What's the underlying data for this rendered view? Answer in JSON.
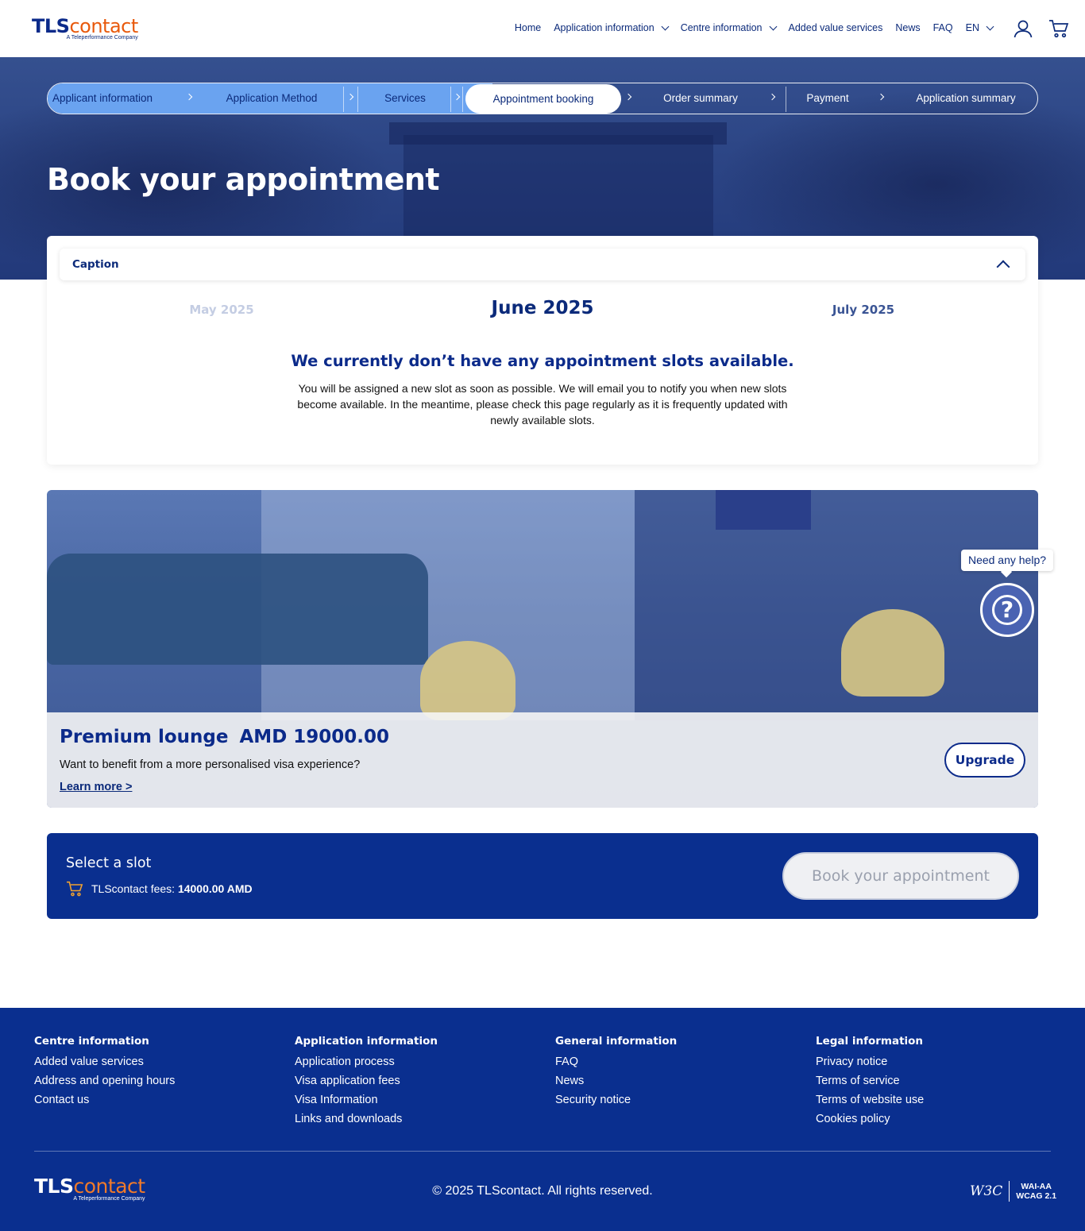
{
  "header": {
    "logo": {
      "brand_a": "TLS",
      "brand_b": "contact",
      "tagline": "A Teleperformance Company"
    },
    "nav": [
      {
        "label": "Home"
      },
      {
        "label": "Application information"
      },
      {
        "label": "Centre information"
      },
      {
        "label": "Added value services"
      },
      {
        "label": "News"
      },
      {
        "label": "FAQ"
      },
      {
        "label": "EN"
      }
    ],
    "icons": {
      "user": "user-icon",
      "cart": "cart-icon"
    }
  },
  "stepper": {
    "steps": [
      {
        "label": "Applicant information",
        "state": "done"
      },
      {
        "label": "Application Method",
        "state": "done"
      },
      {
        "label": "Services",
        "state": "done"
      },
      {
        "label": "Appointment booking",
        "state": "current"
      },
      {
        "label": "Order summary",
        "state": "todo"
      },
      {
        "label": "Payment",
        "state": "todo"
      },
      {
        "label": "Application summary",
        "state": "todo"
      }
    ]
  },
  "hero": {
    "title": "Book your appointment"
  },
  "calendar": {
    "caption": "Caption",
    "prev_month": "May 2025",
    "current_month": "June 2025",
    "next_month": "July 2025",
    "empty_title": "We currently don’t have any appointment slots available.",
    "empty_body": "You will be assigned a new slot as soon as possible. We will email you to notify you when new slots become available. In the meantime, please check this page regularly as it is frequently updated with newly available slots."
  },
  "lounge": {
    "title": "Premium lounge",
    "price": "AMD 19000.00",
    "subtitle": "Want to benefit from a more personalised visa experience?",
    "link": "Learn more >",
    "button": "Upgrade"
  },
  "help": {
    "bubble": "Need any help?",
    "icon": "?"
  },
  "slot_bar": {
    "title": "Select a slot",
    "fee_label": "TLScontact fees:",
    "fee_value": "14000.00 AMD",
    "button": "Book your appointment"
  },
  "footer": {
    "columns": [
      {
        "heading": "Centre information",
        "links": [
          "Added value services",
          "Address and opening hours",
          "Contact us"
        ]
      },
      {
        "heading": "Application information",
        "links": [
          "Application process",
          "Visa application fees",
          "Visa Information",
          "Links and downloads"
        ]
      },
      {
        "heading": "General information",
        "links": [
          "FAQ",
          "News",
          "Security notice"
        ]
      },
      {
        "heading": "Legal information",
        "links": [
          "Privacy notice",
          "Terms of service",
          "Terms of website use",
          "Cookies policy"
        ]
      }
    ],
    "logo": {
      "brand_a": "TLS",
      "brand_b": "contact",
      "tagline": "A Teleperformance Company"
    },
    "copyright": "© 2025 TLScontact. All rights reserved.",
    "wcag": {
      "w3c": "W3C",
      "line1": "WAI-AA",
      "line2": "WCAG 2.1"
    }
  },
  "colors": {
    "brand_blue": "#0a2f8f",
    "brand_orange": "#e8590c",
    "step_done": "#6aa3f0"
  }
}
